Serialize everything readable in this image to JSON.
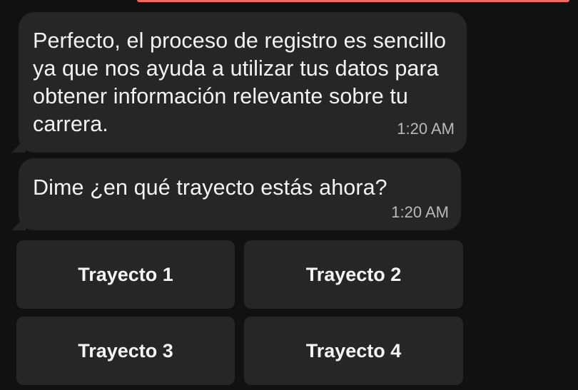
{
  "messages": [
    {
      "text": "Perfecto, el proceso de registro es sencillo ya que nos ayuda a utilizar tus datos para obtener información relevante sobre tu carrera.",
      "time": "1:20 AM"
    },
    {
      "text": "Dime ¿en qué trayecto estás ahora?",
      "time": "1:20 AM"
    }
  ],
  "quick_replies": [
    {
      "label": "Trayecto 1"
    },
    {
      "label": "Trayecto 2"
    },
    {
      "label": "Trayecto 3"
    },
    {
      "label": "Trayecto 4"
    }
  ],
  "colors": {
    "background": "#111111",
    "bubble": "#262626",
    "text": "#f3f3f3",
    "time": "#b9b9b9",
    "accent": "#f06a63"
  }
}
